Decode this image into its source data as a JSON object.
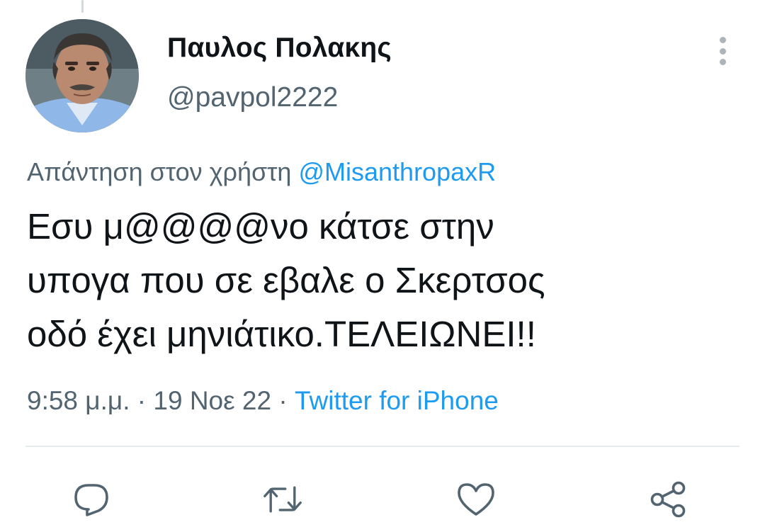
{
  "author": {
    "display_name": "Παυλος Πολακης",
    "handle": "@pavpol2222"
  },
  "reply": {
    "prefix": "Απάντηση στον χρήστη",
    "mention": "@MisanthropaxR"
  },
  "tweet": {
    "lines": [
      "Εσυ μ@@@@νο κάτσε στην",
      "υπογα που σε εβαλε ο Σκερτσος",
      "οδό έχει μηνιάτικο.ΤΕΛΕΙΩΝΕΙ!!"
    ]
  },
  "meta": {
    "time": "9:58 μ.μ.",
    "separator": "·",
    "date": "19 Νοε 22",
    "source": "Twitter for iPhone"
  },
  "actions": {
    "icons": [
      "reply-icon",
      "retweet-icon",
      "like-icon",
      "share-icon"
    ],
    "icon_color": "#536471"
  },
  "colors": {
    "accent": "#1d9bf0",
    "secondary_text": "#536471"
  }
}
